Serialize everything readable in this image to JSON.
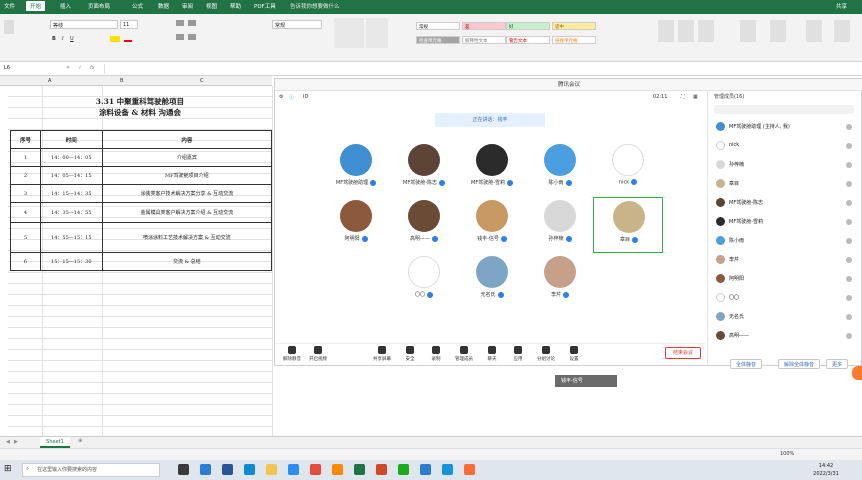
{
  "excel": {
    "menu": [
      "文件",
      "开始",
      "插入",
      "页面布局",
      "公式",
      "数据",
      "审阅",
      "视图",
      "帮助",
      "PDF工具",
      "告诉我你想要做什么"
    ],
    "active_menu": "开始",
    "share": "共享",
    "font_name": "等线",
    "font_size": "11",
    "number_format": "常规",
    "styles": [
      {
        "label": "常规",
        "bg": "#ffffff",
        "fg": "#222222"
      },
      {
        "label": "差",
        "bg": "#ffc7ce",
        "fg": "#9c0006"
      },
      {
        "label": "好",
        "bg": "#c6efce",
        "fg": "#006100"
      },
      {
        "label": "适中",
        "bg": "#ffeb9c",
        "fg": "#9c6500"
      },
      {
        "label": "检查单元格",
        "bg": "#a5a5a5",
        "fg": "#ffffff"
      },
      {
        "label": "解释性文本",
        "bg": "#ffffff",
        "fg": "#7f7f7f"
      },
      {
        "label": "警告文本",
        "bg": "#ffffff",
        "fg": "#ff0000"
      },
      {
        "label": "链接单元格",
        "bg": "#ffffff",
        "fg": "#fa7d00"
      }
    ],
    "name_box": "L6",
    "columns": [
      "A",
      "B",
      "C"
    ],
    "sheet_title_line1": "3.31 中聚重科驾驶舱项目",
    "sheet_title_line2": "涂料设备 & 材料 沟通会",
    "table_headers": [
      "序号",
      "时间",
      "内容"
    ],
    "rows": [
      {
        "no": "1",
        "time": "14：00—14：05",
        "content": "介绍嘉宾"
      },
      {
        "no": "2",
        "time": "14：05—14：15",
        "content": "MF驾驶舱项目介绍"
      },
      {
        "no": "3",
        "time": "14：15—14：35",
        "content": "涂装类客户技术解决方案分享 & 互动交流"
      },
      {
        "no": "4",
        "time": "14：35—14：55",
        "content": "金属模具类客户解决方案介绍 & 互动交流"
      },
      {
        "no": "5",
        "time": "14：55—15：15",
        "content": "喷涂涂料工艺技术解决方案 & 互动交流"
      },
      {
        "no": "6",
        "time": "15：15—15：30",
        "content": "交流 & 总结"
      }
    ],
    "sheet_tab": "Sheet1",
    "zoom": "100%"
  },
  "meeting": {
    "window_title": "腾讯会议",
    "meeting_id": "ID",
    "timer": "02:11",
    "notice": "正在讲话：钱丰",
    "participants_title": "管理成员(16)",
    "tiles": [
      {
        "name": "MF驾驶舱助理",
        "color": "#3f8fd2"
      },
      {
        "name": "MF驾驶舱-陈志",
        "color": "#5c4535"
      },
      {
        "name": "MF驾驶舱-雪莉",
        "color": "#2b2b2b"
      },
      {
        "name": "陈小雨",
        "color": "#4a9fe0"
      },
      {
        "name": "nick",
        "color": "#ffffff"
      },
      {
        "name": "阿明阳",
        "color": "#8b5a3c"
      },
      {
        "name": "高明——",
        "color": "#6b4a36"
      },
      {
        "name": "钱丰-信号",
        "color": "#c79a64"
      },
      {
        "name": "孙梓楠",
        "color": "#d8d8d8"
      },
      {
        "name": "章目",
        "color": "#c9b48a"
      },
      {
        "name": "〇〇",
        "color": "#ffffff"
      },
      {
        "name": "无名氏",
        "color": "#7ea6c4"
      },
      {
        "name": "李芹",
        "color": "#c6a08a"
      }
    ],
    "toolbar": [
      "解除静音",
      "开启视频",
      "共享屏幕",
      "安全",
      "录制",
      "管理成员",
      "聊天",
      "应用",
      "分组讨论",
      "设置"
    ],
    "end_button": "结束会议",
    "participants": [
      {
        "name": "MF驾驶舱助理",
        "sub": "(主持人, 我)",
        "color": "#3f8fd2"
      },
      {
        "name": "nick",
        "sub": "",
        "color": "#ffffff"
      },
      {
        "name": "孙梓楠",
        "sub": "",
        "color": "#d8d8d8"
      },
      {
        "name": "章目",
        "sub": "",
        "color": "#c9b48a"
      },
      {
        "name": "MF驾驶舱-陈志",
        "sub": "",
        "color": "#5c4535"
      },
      {
        "name": "MF驾驶舱-雪莉",
        "sub": "",
        "color": "#2b2b2b"
      },
      {
        "name": "陈小雨",
        "sub": "",
        "color": "#4a9fe0"
      },
      {
        "name": "李芹",
        "sub": "",
        "color": "#c6a08a"
      },
      {
        "name": "阿明阳",
        "sub": "",
        "color": "#8b5a3c"
      },
      {
        "name": "〇〇",
        "sub": "",
        "color": "#ffffff"
      },
      {
        "name": "无名氏",
        "sub": "",
        "color": "#7ea6c4"
      },
      {
        "name": "高明——",
        "sub": "",
        "color": "#6b4a36"
      }
    ],
    "plist_buttons": [
      "全体静音",
      "解除全体静音",
      "更多"
    ],
    "tooltip": "钱丰-信号"
  },
  "taskbar": {
    "search_placeholder": "在这里输入你要搜索的内容",
    "time": "14:42",
    "date": "2022/3/31",
    "icons": [
      {
        "name": "task-view-icon",
        "color": "#3a3a3a"
      },
      {
        "name": "mail-icon",
        "color": "#2b7cd3"
      },
      {
        "name": "word-icon",
        "color": "#2b579a"
      },
      {
        "name": "edge-icon",
        "color": "#0f8bd6"
      },
      {
        "name": "folder-icon",
        "color": "#f4c54d"
      },
      {
        "name": "meeting-icon",
        "color": "#2d8cf0"
      },
      {
        "name": "chrome-icon",
        "color": "#e84a3c"
      },
      {
        "name": "app-icon",
        "color": "#ff8a00"
      },
      {
        "name": "excel-icon",
        "color": "#217346"
      },
      {
        "name": "powerpoint-icon",
        "color": "#d24726"
      },
      {
        "name": "wechat-icon",
        "color": "#1aad19"
      },
      {
        "name": "store-icon",
        "color": "#2b7cd3"
      },
      {
        "name": "qq-icon",
        "color": "#1296db"
      },
      {
        "name": "photos-icon",
        "color": "#ff6b35"
      }
    ]
  }
}
